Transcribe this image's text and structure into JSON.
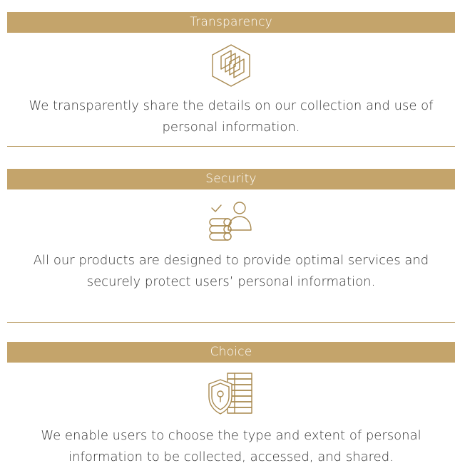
{
  "theme": {
    "accent": "#c4a46b",
    "icon_stroke": "#a8894f",
    "text": "#333333"
  },
  "sections": [
    {
      "title": "Transparency",
      "icon": "layered-hexagon-icon",
      "description": "We transparently share the details on our collection and use of personal information."
    },
    {
      "title": "Security",
      "icon": "user-check-database-icon",
      "description": "All our products are designed to provide optimal services and securely protect users’ personal information."
    },
    {
      "title": "Choice",
      "icon": "shield-lock-list-icon",
      "description": "We enable users to choose the type and extent of personal information to be collected, accessed, and shared."
    }
  ]
}
